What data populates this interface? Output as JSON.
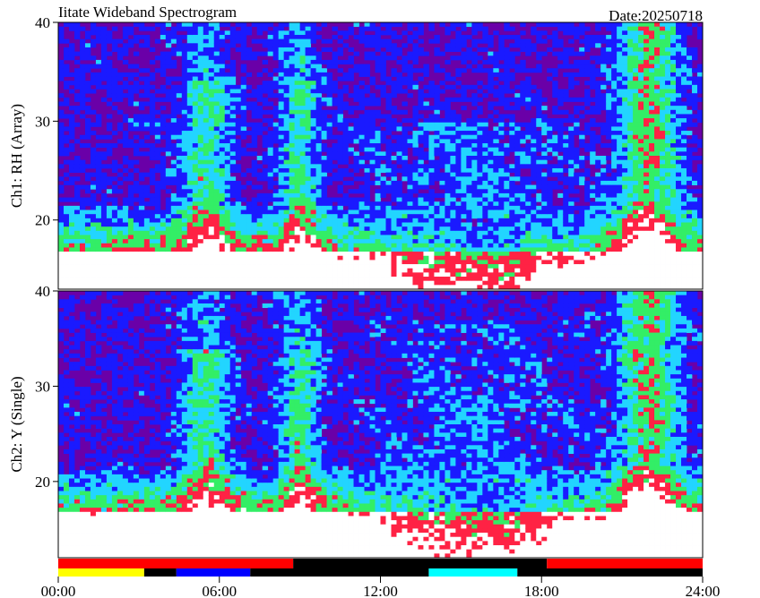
{
  "chart_data": {
    "type": "heatmap",
    "title": "Iitate Wideband Spectrogram",
    "date_label": "Date:20250718",
    "x_range_hours": [
      0,
      24
    ],
    "x_ticks": [
      {
        "value": 0,
        "label": "00:00"
      },
      {
        "value": 6,
        "label": "06:00"
      },
      {
        "value": 12,
        "label": "12:00"
      },
      {
        "value": 18,
        "label": "18:00"
      },
      {
        "value": 24,
        "label": "24:00"
      }
    ],
    "panels": [
      {
        "ylabel": "Ch1: RH (Array)",
        "y_range": [
          13,
          40
        ],
        "y_ticks": [
          20,
          30,
          40
        ]
      },
      {
        "ylabel": "Ch2: Y (Single)",
        "y_range": [
          12,
          40
        ],
        "y_ticks": [
          20,
          30,
          40
        ]
      }
    ],
    "colormap": [
      "#6a00a8",
      "#1a1aff",
      "#22d5ff",
      "#33ee66",
      "#ff2244",
      "#ffffff"
    ],
    "status_bar": {
      "upper_row": [
        {
          "start": 0,
          "end": 8.75,
          "color": "#ff0000"
        },
        {
          "start": 8.75,
          "end": 18.2,
          "color": "#000000"
        },
        {
          "start": 18.2,
          "end": 24,
          "color": "#ff0000"
        }
      ],
      "lower_row": [
        {
          "start": 0,
          "end": 3.2,
          "color": "#ffff00"
        },
        {
          "start": 3.2,
          "end": 4.4,
          "color": "#000000"
        },
        {
          "start": 4.4,
          "end": 7.15,
          "color": "#0000ff"
        },
        {
          "start": 7.15,
          "end": 13.8,
          "color": "#000000"
        },
        {
          "start": 13.8,
          "end": 17.1,
          "color": "#00ffff"
        },
        {
          "start": 17.1,
          "end": 24,
          "color": "#000000"
        }
      ]
    }
  }
}
